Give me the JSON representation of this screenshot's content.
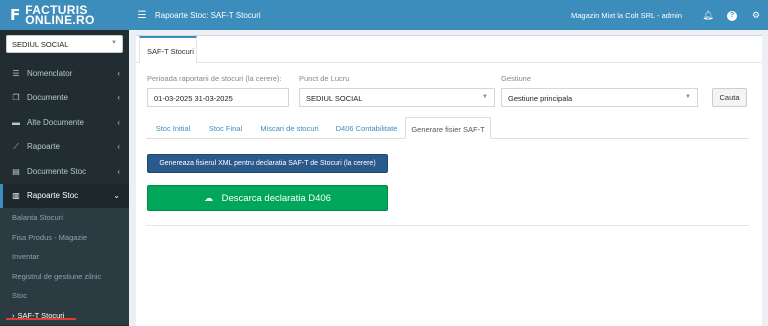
{
  "logo": {
    "mark": "F",
    "line1": "FACTURIS",
    "line2": "ONLINE.RO"
  },
  "sidebar": {
    "location": "SEDIUL SOCIAL",
    "items": [
      {
        "label": "Nomenclator",
        "icon": "list-icon"
      },
      {
        "label": "Documente",
        "icon": "copy-icon"
      },
      {
        "label": "Alte Documente",
        "icon": "folder-icon"
      },
      {
        "label": "Rapoarte",
        "icon": "line-chart-icon"
      },
      {
        "label": "Documente Stoc",
        "icon": "document-icon"
      },
      {
        "label": "Rapoarte Stoc",
        "icon": "bar-chart-icon"
      }
    ],
    "submenu": [
      "Balanta Stocuri",
      "Fisa Produs - Magazie",
      "Inventar",
      "Registrul de gestiune zilnic",
      "Stoc",
      "SAF-T Stocuri"
    ]
  },
  "topbar": {
    "title": "Rapoarte Stoc: SAF-T Stocuri",
    "company": "Magazin Mixt la Colt SRL - admin"
  },
  "main": {
    "box_tab": "SAF-T Stocuri",
    "period_label": "Perioada raportarii de stocuri (la cerere):",
    "period_value": "01-03-2025  31-03-2025",
    "work_point_label": "Punct de Lucru",
    "work_point_value": "SEDIUL SOCIAL",
    "gestiune_label": "Gestiune",
    "gestiune_value": "Gestiune principala",
    "search_button": "Cauta",
    "tabs": [
      "Stoc Initial",
      "Stoc Final",
      "Miscari de stocuri",
      "D406 Contabilitate",
      "Generare fisier SAF-T"
    ],
    "generate_button": "Genereaza fisierul XML pentru declaratia SAF-T de Stocuri (la cerere)",
    "download_button": "Descarca declaratia D406"
  },
  "colors": {
    "accent": "#3c8dbc",
    "sidebar": "#222d32",
    "success": "#00a65a",
    "primary_dark": "#2a5a8c"
  }
}
